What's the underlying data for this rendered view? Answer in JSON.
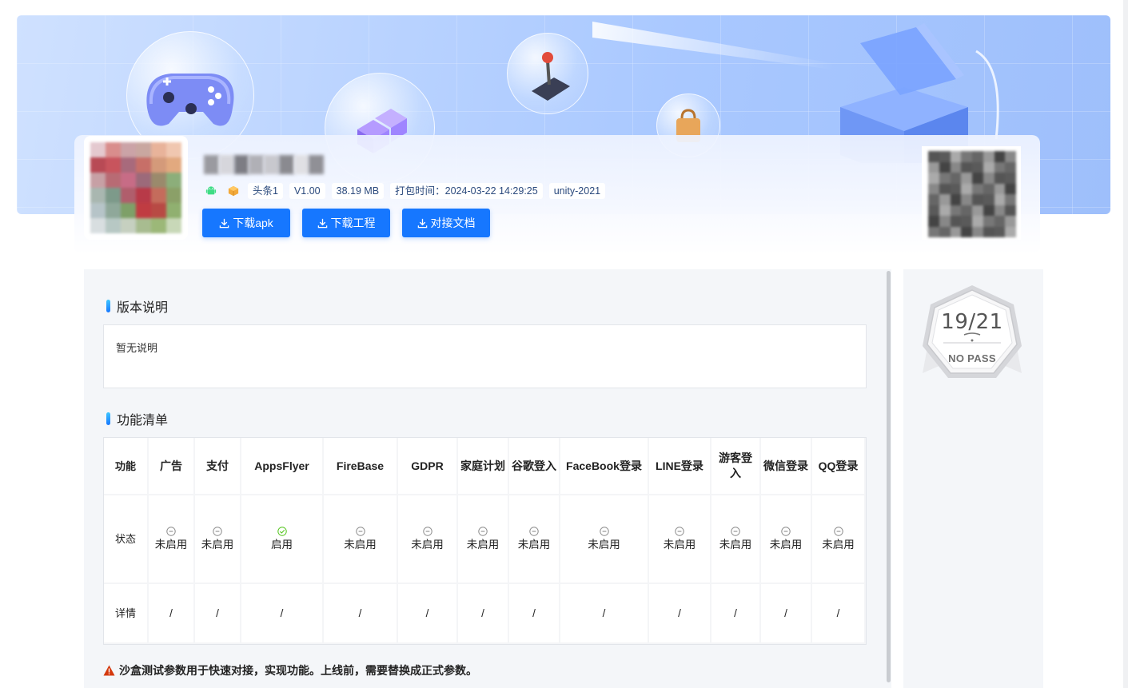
{
  "app": {
    "channel_tag": "头条1",
    "version": "V1.00",
    "size": "38.19 MB",
    "build_time": "打包时间：2024-03-22 14:29:25",
    "engine": "unity-2021",
    "platform_icons": [
      "android-icon",
      "package-icon"
    ]
  },
  "actions": {
    "download_apk": "下载apk",
    "download_project": "下载工程",
    "docs": "对接文档"
  },
  "version_notes": {
    "title": "版本说明",
    "content": "暂无说明"
  },
  "feature_list": {
    "title": "功能清单",
    "row_labels": [
      "功能",
      "状态",
      "详情"
    ],
    "columns": [
      {
        "name": "广告",
        "status": "未启用",
        "enabled": false,
        "detail": "/"
      },
      {
        "name": "支付",
        "status": "未启用",
        "enabled": false,
        "detail": "/"
      },
      {
        "name": "AppsFlyer",
        "status": "启用",
        "enabled": true,
        "detail": "/"
      },
      {
        "name": "FireBase",
        "status": "未启用",
        "enabled": false,
        "detail": "/"
      },
      {
        "name": "GDPR",
        "status": "未启用",
        "enabled": false,
        "detail": "/"
      },
      {
        "name": "家庭计划",
        "status": "未启用",
        "enabled": false,
        "detail": "/"
      },
      {
        "name": "谷歌登入",
        "status": "未启用",
        "enabled": false,
        "detail": "/"
      },
      {
        "name": "FaceBook登录",
        "status": "未启用",
        "enabled": false,
        "detail": "/"
      },
      {
        "name": "LINE登录",
        "status": "未启用",
        "enabled": false,
        "detail": "/"
      },
      {
        "name": "游客登入",
        "status": "未启用",
        "enabled": false,
        "detail": "/"
      },
      {
        "name": "微信登录",
        "status": "未启用",
        "enabled": false,
        "detail": "/"
      },
      {
        "name": "QQ登录",
        "status": "未启用",
        "enabled": false,
        "detail": "/"
      }
    ]
  },
  "warning": "沙盒测试参数用于快速对接，实现功能。上线前，需要替换成正式参数。",
  "badge": {
    "score": "19/21",
    "label": "NO PASS"
  },
  "colors": {
    "primary": "#1677ff",
    "enabled": "#52c41a",
    "disabled": "#8c8c8c",
    "warning": "#d4380d"
  }
}
